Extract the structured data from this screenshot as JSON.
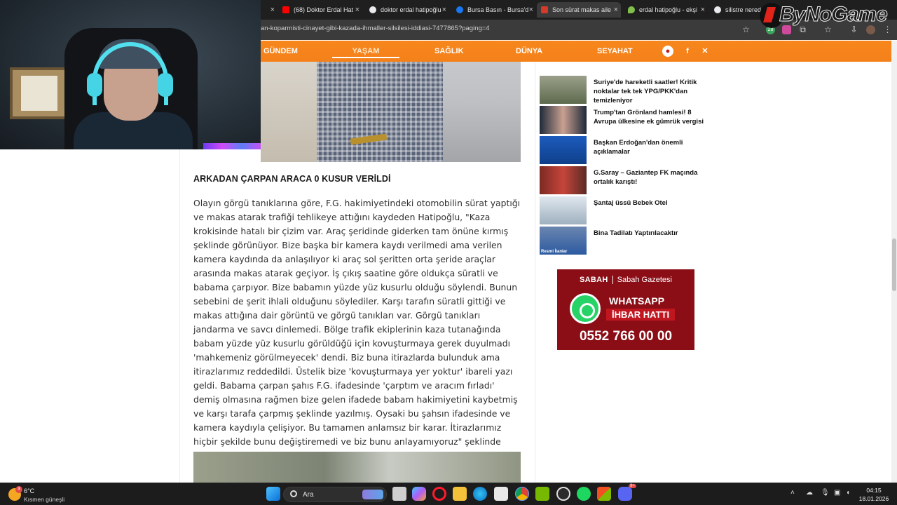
{
  "browser": {
    "tabs": [
      {
        "label": "",
        "fav_color": "#2b2b2b"
      },
      {
        "label": "(68) Doktor Erdal Hat",
        "fav_color": "#ff0000"
      },
      {
        "label": "doktor erdal hatipoğlu",
        "fav_color": "#e8eaed"
      },
      {
        "label": "Bursa Basın - Bursa'd",
        "fav_color": "#1877f2"
      },
      {
        "label": "Son sürat makas aile",
        "fav_color": "#d33a2c"
      },
      {
        "label": "erdal hatipoğlu - ekşi",
        "fav_color": "#81c14b"
      },
      {
        "label": "silistre nerede",
        "fav_color": "#e8eaed"
      }
    ],
    "url": "an-koparmisti-cinayet-gibi-kazada-ihmaller-silsilesi-iddiasi-7477865?paging=4",
    "badge_count": "28"
  },
  "site_nav": {
    "items": [
      "GÜNDEM",
      "YAŞAM",
      "SAĞLIK",
      "DÜNYA",
      "SEYAHAT"
    ],
    "active": "YAŞAM"
  },
  "article": {
    "heading": "ARKADAN ÇARPAN ARACA 0 KUSUR VERİLDİ",
    "paragraph": "Olayın görgü tanıklarına göre, F.G. hakimiyetindeki otomobilin sürat yaptığı ve makas atarak trafiği tehlikeye attığını kaydeden Hatipoğlu, \"Kaza krokisinde hatalı bir çizim var. Araç şeridinde giderken tam önüne kırmış şeklinde görünüyor. Bize başka bir kamera kaydı verilmedi ama verilen kamera kaydında da anlaşılıyor ki araç sol şeritten orta şeride araçlar arasında makas atarak geçiyor. İş çıkış saatine göre oldukça süratli ve babama çarpıyor. Bize babamın yüzde yüz kusurlu olduğu söylendi. Bunun sebebini de şerit ihlali olduğunu söylediler. Karşı tarafın süratli gittiği ve makas attığına dair görüntü ve görgü tanıkları var. Görgü tanıkları jandarma ve savcı dinlemedi. Bölge trafik ekiplerinin kaza tutanağında babam yüzde yüz kusurlu görüldüğü için kovuşturmaya gerek duyulmadı 'mahkemeniz görülmeyecek' dendi. Biz buna itirazlarda bulunduk ama itirazlarımız reddedildi. Üstelik bize 'kovuşturmaya yer yoktur' ibareli yazı geldi. Babama çarpan şahıs F.G. ifadesinde 'çarptım ve aracım fırladı' demiş olmasına rağmen bize gelen ifadede babam hakimiyetini kaybetmiş ve karşı tarafa çarpmış şeklinde yazılmış. Oysaki bu şahsın ifadesinde ve kamera kaydıyla çelişiyor. Bu tamamen anlamsız bir karar. İtirazlarımız hiçbir şekilde bunu değiştiremedi ve biz bunu anlayamıyoruz\" şeklinde konuştu."
  },
  "sidebar": {
    "news": [
      {
        "title": "Suriye'de hareketli saatler! Kritik noktalar tek tek YPG/PKK'dan temizleniyor",
        "thumb": "#6d7a5a"
      },
      {
        "title": "Trump'tan Grönland hamlesi! 8 Avrupa ülkesine ek gümrük vergisi",
        "thumb": "#8b2b2b"
      },
      {
        "title": "Başkan Erdoğan'dan önemli açıklamalar",
        "thumb": "#1e4fa8"
      },
      {
        "title": "G.Saray – Gaziantep FK maçında ortalık karıştı!",
        "thumb": "#9b3a2c"
      },
      {
        "title": "Şantaj üssü Bebek Otel",
        "thumb": "#b7c4cf"
      },
      {
        "title": "Bina Tadilatı Yaptırılacaktır",
        "thumb": "#2c5aa0",
        "tag": "Resmi İlanlar"
      }
    ],
    "ad": {
      "brand": "SABAH",
      "label": "Sabah Gazetesi",
      "whatsapp": "WHATSAPP",
      "ihbar": "İHBAR HATTI",
      "phone": "0552 766 00 00"
    }
  },
  "overlay": {
    "brand": "ByNoGame"
  },
  "taskbar": {
    "temperature": "6°C",
    "condition": "Kısmen güneşli",
    "weather_badge": "3",
    "search_label": "Ara",
    "time": "04:15",
    "date": "18.01.2026",
    "discord_badge": "9+"
  }
}
